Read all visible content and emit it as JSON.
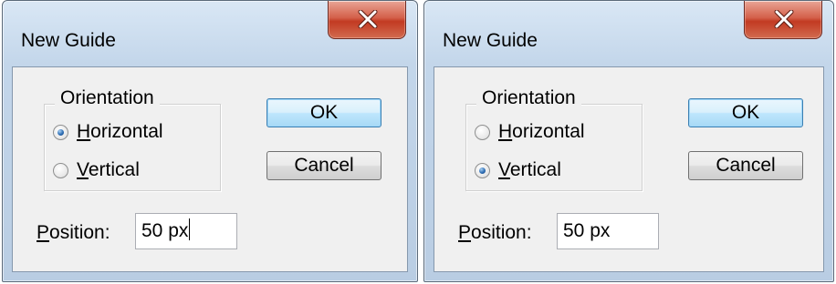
{
  "dialogs": [
    {
      "title": "New Guide",
      "orientation": {
        "legend": "Orientation",
        "options": [
          {
            "mnemonic": "H",
            "rest": "orizontal",
            "checked": true
          },
          {
            "mnemonic": "V",
            "rest": "ertical",
            "checked": false
          }
        ]
      },
      "ok_label": "OK",
      "cancel_label": "Cancel",
      "position": {
        "mnemonic": "P",
        "rest": "osition:",
        "value": "50 px",
        "focused": true
      }
    },
    {
      "title": "New Guide",
      "orientation": {
        "legend": "Orientation",
        "options": [
          {
            "mnemonic": "H",
            "rest": "orizontal",
            "checked": false
          },
          {
            "mnemonic": "V",
            "rest": "ertical",
            "checked": true
          }
        ]
      },
      "ok_label": "OK",
      "cancel_label": "Cancel",
      "position": {
        "mnemonic": "P",
        "rest": "osition:",
        "value": "50 px",
        "focused": false
      }
    }
  ],
  "icons": {
    "close": "close-icon",
    "radio": "radio-button-icon"
  },
  "colors": {
    "close_button": "#c23a22",
    "title_bar": "#c3d6ea",
    "client": "#f0f0f0",
    "default_button": "#bee6fd",
    "radio_dot": "#2f6fb5"
  }
}
